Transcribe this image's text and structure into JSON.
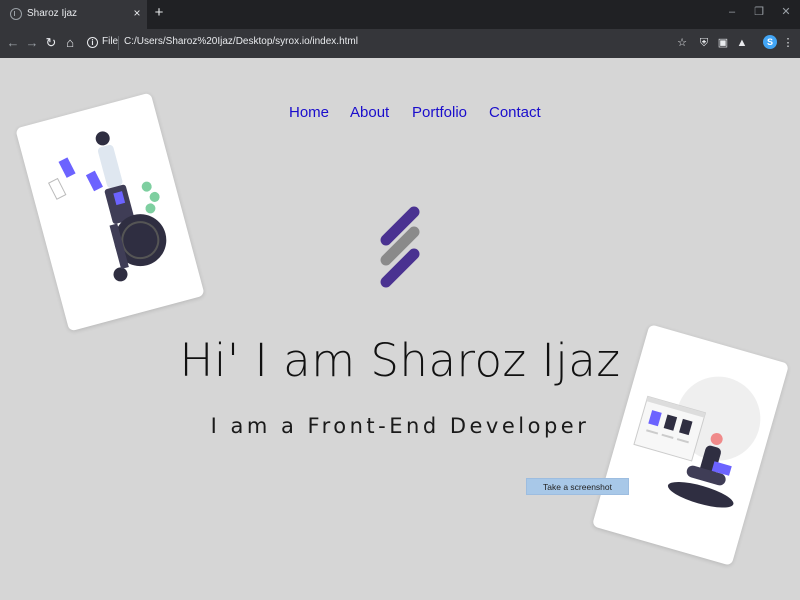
{
  "browser": {
    "tab_title": "Sharoz Ijaz",
    "tab_close": "×",
    "new_tab": "+",
    "address_scheme": "File",
    "address_url": "C:/Users/Sharoz%20Ijaz/Desktop/syrox.io/index.html",
    "profile_initial": "S"
  },
  "nav": {
    "items": [
      "Home",
      "About",
      "Portfolio",
      "Contact"
    ]
  },
  "hero": {
    "title": "Hi' I am Sharoz Ijaz",
    "subtitle": "I am a Front-End Developer"
  },
  "overlay": {
    "screenshot_button": "Take a screenshot"
  },
  "colors": {
    "page_background": "#d6d6d6",
    "nav_link": "#1a0dcc",
    "logo_purple": "#4a3291",
    "logo_gray": "#8a8a8a",
    "accent_illustration": "#6c63ff"
  },
  "icons": [
    "back-icon",
    "forward-icon",
    "reload-icon",
    "home-icon",
    "info-icon",
    "star-icon",
    "shield-icon",
    "camera-icon",
    "extension-icon",
    "menu-icon"
  ]
}
